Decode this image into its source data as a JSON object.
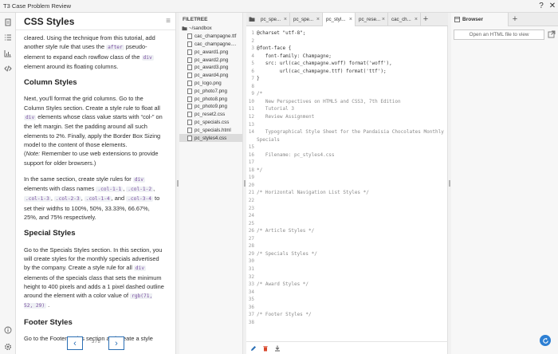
{
  "window": {
    "title": "T3 Case Problem Review",
    "help_icon": "help-icon",
    "close_icon": "close-icon"
  },
  "rail": {
    "icons": [
      "document-icon",
      "list-icon",
      "chart-icon",
      "code-icon",
      "info-icon",
      "settings-icon"
    ]
  },
  "instructions": {
    "title": "CSS Styles",
    "p1": {
      "a": "cleared. Using the technique from this tutorial, add another style rule that uses the ",
      "code1": "after",
      "b": " pseudo-element to expand each rowflow class of the ",
      "code2": "div",
      "c": " element around its floating columns."
    },
    "h_columns": "Column Styles",
    "p2": {
      "a": "Next, you'll format the grid columns. Go to the Column Styles section. Create a style rule to float all ",
      "code1": "div",
      "b": " elements whose class value starts with “col-” on the left margin. Set the padding around all such elements to 2%. Finally, apply the Border Box Sizing model to the content of those elements."
    },
    "p3": {
      "note_label": "Note:",
      "text": " Remember to use web extensions to provide support for older browsers.)"
    },
    "p4": {
      "a": "In the same section, create style rules for ",
      "code1": "div",
      "b": " elements with class names ",
      "code2": ".col-1-1",
      "sep1": ", ",
      "code3": ".col-1-2",
      "sep2": ", ",
      "code4": ".col-1-3",
      "sep3": ", ",
      "code5": ".col-2-3",
      "sep4": ", ",
      "code6": ".col-1-4",
      "sep5": ", and ",
      "code7": ".col-3-4",
      "c": " to set their widths to 100%, 50%, 33.33%, 66.67%, 25%, and 75% respectively."
    },
    "h_special": "Special Styles",
    "p5": {
      "a": "Go to the Specials Styles section. In this section, you will create styles for the monthly specials advertised by the company. Create a style rule for all ",
      "code1": "div",
      "b": " elements of the specials class that sets the minimum height to 400 pixels and adds a 1 pixel dashed outline around the element with a color value of ",
      "code2": "rgb(71, 52, 29)",
      "c": " ."
    },
    "h_footer": "Footer Styles",
    "p6": "Go to the Footer Styles section and create a style rule",
    "pager": {
      "prev": "‹",
      "next": "›",
      "text": "3 / 5"
    }
  },
  "filetree": {
    "header": "FILETREE",
    "root": "~/sandbox",
    "files": [
      {
        "name": "cac_champagne.ttf",
        "selected": false
      },
      {
        "name": "cac_champagne....",
        "selected": false
      },
      {
        "name": "pc_award1.png",
        "selected": false
      },
      {
        "name": "pc_award2.png",
        "selected": false
      },
      {
        "name": "pc_award3.png",
        "selected": false
      },
      {
        "name": "pc_award4.png",
        "selected": false
      },
      {
        "name": "pc_logo.png",
        "selected": false
      },
      {
        "name": "pc_photo7.png",
        "selected": false
      },
      {
        "name": "pc_photo8.png",
        "selected": false
      },
      {
        "name": "pc_photo9.png",
        "selected": false
      },
      {
        "name": "pc_reset2.css",
        "selected": false
      },
      {
        "name": "pc_specials.css",
        "selected": false
      },
      {
        "name": "pc_specials.html",
        "selected": false
      },
      {
        "name": "pc_styles4.css",
        "selected": true
      }
    ]
  },
  "editor": {
    "tabs": [
      {
        "label": "pc_spe...",
        "active": false
      },
      {
        "label": "pc_spe...",
        "active": false
      },
      {
        "label": "pc_styl...",
        "active": true
      },
      {
        "label": "pc_rese...",
        "active": false
      },
      {
        "label": "cac_ch...",
        "active": false
      }
    ],
    "add_tab": "+",
    "lines": [
      {
        "n": "1",
        "t": "@charset \"utf-8\";",
        "c": "at"
      },
      {
        "n": "2",
        "t": "",
        "c": ""
      },
      {
        "n": "3",
        "t": "@font-face {",
        "c": "at"
      },
      {
        "n": "4",
        "t": "   font-family: Champagne;",
        "c": ""
      },
      {
        "n": "5",
        "t": "   src: url(cac_champagne.woff) format('woff'),",
        "c": ""
      },
      {
        "n": "6",
        "t": "        url(cac_champagne.ttf) format('ttf');",
        "c": ""
      },
      {
        "n": "7",
        "t": "}",
        "c": ""
      },
      {
        "n": "8",
        "t": "",
        "c": ""
      },
      {
        "n": "9",
        "t": "/*",
        "c": "cm"
      },
      {
        "n": "10",
        "t": "   New Perspectives on HTML5 and CSS3, 7th Edition",
        "c": "cm"
      },
      {
        "n": "",
        "t": "   Tutorial 3",
        "c": "cm"
      },
      {
        "n": "",
        "t": "   Review Assignment",
        "c": "cm"
      },
      {
        "n": "",
        "t": "",
        "c": ""
      },
      {
        "n": "",
        "t": "   Typographical Style Sheet for the Pandaisia Chocolates Monthly",
        "c": "cm"
      },
      {
        "n": "",
        "t": "Specials",
        "c": "cm"
      },
      {
        "n": "",
        "t": "",
        "c": ""
      },
      {
        "n": "",
        "t": "   Filename: pc_styles4.css",
        "c": "cm"
      },
      {
        "n": "",
        "t": "",
        "c": ""
      },
      {
        "n": "",
        "t": "*/",
        "c": "cm"
      },
      {
        "n": "",
        "t": "",
        "c": ""
      },
      {
        "n": "",
        "t": "",
        "c": ""
      },
      {
        "n": "",
        "t": "/* Horizontal Navigation List Styles */",
        "c": "cm"
      },
      {
        "n": "",
        "t": "",
        "c": ""
      },
      {
        "n": "",
        "t": "",
        "c": ""
      },
      {
        "n": "",
        "t": "",
        "c": ""
      },
      {
        "n": "",
        "t": "",
        "c": ""
      },
      {
        "n": "",
        "t": "/* Article Styles */",
        "c": "cm"
      },
      {
        "n": "",
        "t": "",
        "c": ""
      },
      {
        "n": "",
        "t": "",
        "c": ""
      },
      {
        "n": "",
        "t": "/* Specials Styles */",
        "c": "cm"
      },
      {
        "n": "",
        "t": "",
        "c": ""
      },
      {
        "n": "",
        "t": "",
        "c": ""
      },
      {
        "n": "",
        "t": "",
        "c": ""
      },
      {
        "n": "",
        "t": "/* Award Styles */",
        "c": "cm"
      },
      {
        "n": "",
        "t": "",
        "c": ""
      },
      {
        "n": "",
        "t": "",
        "c": ""
      },
      {
        "n": "",
        "t": "",
        "c": ""
      },
      {
        "n": "",
        "t": "/* Footer Styles */",
        "c": "cm"
      },
      {
        "n": "",
        "t": "",
        "c": ""
      },
      {
        "n": "",
        "t": "",
        "c": ""
      }
    ],
    "line_numbers": [
      "1",
      "2",
      "3",
      "4",
      "5",
      "6",
      "7",
      "8",
      "9",
      "10",
      "11",
      "12",
      "13",
      "14",
      "",
      "15",
      "16",
      "17",
      "18",
      "19",
      "20",
      "21",
      "22",
      "23",
      "24",
      "25",
      "26",
      "27",
      "28",
      "29",
      "30",
      "31",
      "32",
      "33",
      "34",
      "35",
      "36",
      "37",
      "38"
    ]
  },
  "browser": {
    "tab_label": "Browser",
    "add_tab": "+",
    "url_placeholder": "Open an HTML file to view"
  },
  "colors": {
    "accent": "#2b6fb5",
    "code_purple": "#7a4fa0",
    "refresh": "#2d7fd3"
  }
}
